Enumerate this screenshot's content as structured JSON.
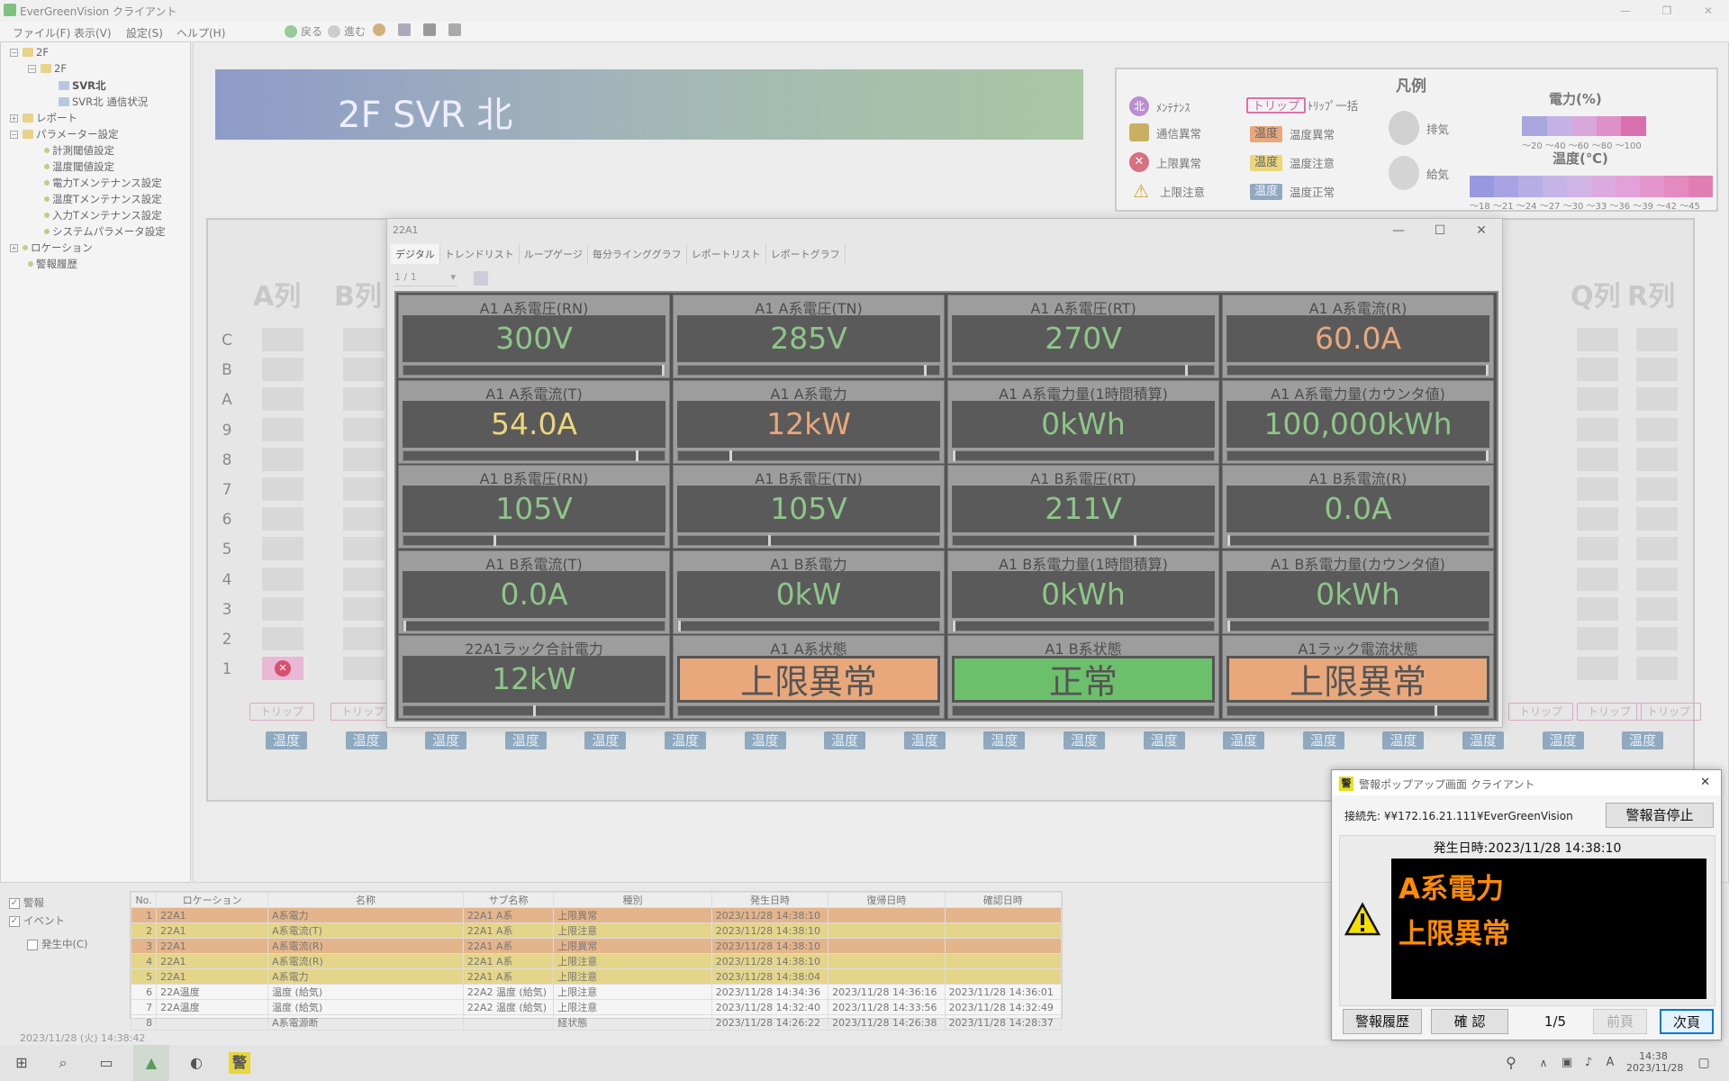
{
  "window": {
    "title": "EverGreenVision クライアント",
    "min": "—",
    "max": "❐",
    "close": "✕"
  },
  "menu": {
    "items": [
      "ファイル(F)",
      "表示(V)",
      "設定(S)",
      "ヘルプ(H)"
    ],
    "back": "戻る",
    "forward": "進む"
  },
  "tree": [
    "2F",
    "2F",
    "SVR北",
    "SVR北 通信状況",
    "レポート",
    "パラメーター設定",
    "計測閾値設定",
    "温度閾値設定",
    "電力Tメンテナンス設定",
    "温度Tメンテナンス設定",
    "入力Tメンテナンス設定",
    "システムパラメータ設定",
    "ロケーション",
    "警報履歴"
  ],
  "banner": {
    "title": "2F SVR 北"
  },
  "legend": {
    "title": "凡例",
    "maint": "ﾒﾝﾃﾅﾝｽ",
    "comm": "通信異常",
    "upper_err": "上限異常",
    "upper_warn": "上限注意",
    "trip_tag": "トリップ",
    "trip_all": "ﾄﾘｯﾌﾟ一括",
    "temp_tag": "温度",
    "temp_err": "温度異常",
    "temp_warn": "温度注意",
    "temp_ok": "温度正常",
    "exhaust": "排気",
    "supply": "給気",
    "power_title": "電力(%)",
    "power_scale": "～20 ～40 ～60 ～80 ～100",
    "temp_title": "温度(℃)",
    "temp_scale": "～18 ～21 ～24 ～27 ～30 ～33 ～36 ～39 ～42 ～45",
    "colors": {
      "err": "#e8a87c",
      "warn": "#ecd67a",
      "ok": "#8fa9bf",
      "trip": "#e0609a"
    },
    "power_ramp": [
      "#a9a6e0",
      "#c4b2e6",
      "#d8a8dc",
      "#e090c8",
      "#d870b0"
    ],
    "temp_ramp": [
      "#9898e0",
      "#a8a4e4",
      "#b8aee6",
      "#c4b4e8",
      "#d0b4e6",
      "#dcaae0",
      "#e4a0d8",
      "#e496cc",
      "#e48ac0",
      "#e07eb4"
    ]
  },
  "columns": {
    "left": [
      "A列",
      "B列"
    ],
    "right": [
      "Q列",
      "R列"
    ]
  },
  "rows": [
    "C",
    "B",
    "A",
    "9",
    "8",
    "7",
    "6",
    "5",
    "4",
    "3",
    "2",
    "1"
  ],
  "tags": {
    "trip": "トリップ",
    "temp": "温度"
  },
  "dialog": {
    "title": "22A1",
    "min": "—",
    "max": "☐",
    "close": "✕",
    "tabs": [
      "デジタル",
      "トレンドリスト",
      "ループゲージ",
      "毎分ラインググラフ",
      "レポートリスト",
      "レポートグラフ"
    ],
    "page": "1 / 1",
    "cells": [
      {
        "label": "A1  A系電圧(RN)",
        "value": "300V",
        "color": "#8fc58a",
        "bar": 1.0
      },
      {
        "label": "A1  A系電圧(TN)",
        "value": "285V",
        "color": "#8fc58a",
        "bar": 0.95
      },
      {
        "label": "A1  A系電圧(RT)",
        "value": "270V",
        "color": "#8fc58a",
        "bar": 0.9
      },
      {
        "label": "A1  A系電流(R)",
        "value": "60.0A",
        "color": "#e8a87c",
        "bar": 1.0
      },
      {
        "label": "A1  A系電流(T)",
        "value": "54.0A",
        "color": "#ecd67a",
        "bar": 0.9
      },
      {
        "label": "A1  A系電力",
        "value": "12kW",
        "color": "#e8a87c",
        "bar": 0.2
      },
      {
        "label": "A1  A系電力量(1時間積算)",
        "value": "0kWh",
        "color": "#8fc58a",
        "bar": 0.0
      },
      {
        "label": "A1  A系電力量(カウンタ値)",
        "value": "100,000kWh",
        "color": "#8fc58a",
        "bar": 1.0
      },
      {
        "label": "A1  B系電圧(RN)",
        "value": "105V",
        "color": "#8fc58a",
        "bar": 0.35
      },
      {
        "label": "A1  B系電圧(TN)",
        "value": "105V",
        "color": "#8fc58a",
        "bar": 0.35
      },
      {
        "label": "A1  B系電圧(RT)",
        "value": "211V",
        "color": "#8fc58a",
        "bar": 0.7
      },
      {
        "label": "A1  B系電流(R)",
        "value": "0.0A",
        "color": "#8fc58a",
        "bar": 0.0
      },
      {
        "label": "A1  B系電流(T)",
        "value": "0.0A",
        "color": "#8fc58a",
        "bar": 0.0
      },
      {
        "label": "A1  B系電力",
        "value": "0kW",
        "color": "#8fc58a",
        "bar": 0.0
      },
      {
        "label": "A1  B系電力量(1時間積算)",
        "value": "0kWh",
        "color": "#8fc58a",
        "bar": 0.0
      },
      {
        "label": "A1  B系電力量(カウンタ値)",
        "value": "0kWh",
        "color": "#8fc58a",
        "bar": 0.0
      },
      {
        "label": "22A1ラック合計電力",
        "value": "12kW",
        "color": "#8fc58a",
        "bar": 0.5
      },
      {
        "label": "A1  A系状態",
        "value": "上限異常",
        "color": "#e8a87c",
        "status": true
      },
      {
        "label": "A1  B系状態",
        "value": "正常",
        "color": "#6cc06c",
        "status": true
      },
      {
        "label": "A1ラック電流状態",
        "value": "上限異常",
        "color": "#e8a87c",
        "status": true,
        "bar": 0.8
      }
    ]
  },
  "filters": {
    "alarm": "警報",
    "event": "イベント",
    "ongoing": "発生中(C)"
  },
  "table": {
    "headers": [
      "No.",
      "ロケーション",
      "名称",
      "サブ名称",
      "種別",
      "発生日時",
      "復帰日時",
      "確認日時"
    ],
    "rows": [
      {
        "c": [
          "1",
          "22A1",
          "A系電力",
          "22A1 A系",
          "上限異常",
          "2023/11/28 14:38:10",
          "",
          ""
        ],
        "s": "o"
      },
      {
        "c": [
          "2",
          "22A1",
          "A系電流(T)",
          "22A1 A系",
          "上限注意",
          "2023/11/28 14:38:10",
          "",
          ""
        ],
        "s": "y"
      },
      {
        "c": [
          "3",
          "22A1",
          "A系電流(R)",
          "22A1 A系",
          "上限異常",
          "2023/11/28 14:38:10",
          "",
          ""
        ],
        "s": "o"
      },
      {
        "c": [
          "4",
          "22A1",
          "A系電流(R)",
          "22A1 A系",
          "上限注意",
          "2023/11/28 14:38:10",
          "",
          ""
        ],
        "s": "y"
      },
      {
        "c": [
          "5",
          "22A1",
          "A系電力",
          "22A1 A系",
          "上限注意",
          "2023/11/28 14:38:04",
          "",
          ""
        ],
        "s": "y"
      },
      {
        "c": [
          "6",
          "22A温度",
          "温度 (給気)",
          "22A2 温度 (給気)",
          "上限注意",
          "2023/11/28 14:34:36",
          "2023/11/28 14:36:16",
          "2023/11/28 14:36:01"
        ],
        "s": ""
      },
      {
        "c": [
          "7",
          "22A温度",
          "温度 (給気)",
          "22A2 温度 (給気)",
          "上限注意",
          "2023/11/28 14:32:40",
          "2023/11/28 14:33:56",
          "2023/11/28 14:32:49"
        ],
        "s": ""
      },
      {
        "c": [
          "8",
          "",
          "A系電源断",
          "",
          "経状態",
          "2023/11/28 14:26:22",
          "2023/11/28 14:26:38",
          "2023/11/28 14:28:37"
        ],
        "s": ""
      }
    ]
  },
  "status": {
    "datetime": "2023/11/28 (火) 14:38:42"
  },
  "taskbar": {
    "time": "14:38",
    "date": "2023/11/28",
    "alarm_icon": "警"
  },
  "popup": {
    "icon": "警",
    "title": "警報ポップアップ画面 クライアント",
    "close": "✕",
    "connection": "接続先: ¥¥172.16.21.111¥EverGreenVision",
    "stop_sound": "警報音停止",
    "occurred": "発生日時:2023/11/28 14:38:10",
    "line1": "A系電力",
    "line2": "上限異常",
    "history": "警報履歴",
    "confirm": "確 認",
    "page": "1/5",
    "prev": "前頁",
    "next": "次頁"
  }
}
